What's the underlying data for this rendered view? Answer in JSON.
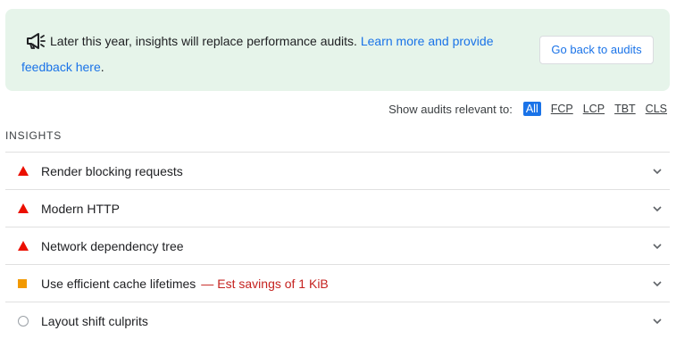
{
  "banner": {
    "message": "Later this year, insights will replace performance audits.",
    "link_text": "Learn more and provide feedback here",
    "suffix": ".",
    "back_button": "Go back to audits"
  },
  "filter": {
    "label": "Show audits relevant to:",
    "options": [
      "All",
      "FCP",
      "LCP",
      "TBT",
      "CLS"
    ],
    "selected": "All"
  },
  "insights": {
    "title": "INSIGHTS",
    "items": [
      {
        "label": "Render blocking requests",
        "status": "fail",
        "savings": ""
      },
      {
        "label": "Modern HTTP",
        "status": "fail",
        "savings": ""
      },
      {
        "label": "Network dependency tree",
        "status": "fail",
        "savings": ""
      },
      {
        "label": "Use efficient cache lifetimes",
        "status": "average",
        "savings": "Est savings of 1 KiB"
      },
      {
        "label": "Layout shift culprits",
        "status": "neutral",
        "savings": ""
      }
    ]
  },
  "colors": {
    "fail": "#eb0f00",
    "average": "#f29900",
    "neutral": "#9aa0a6",
    "accent": "#1a73e8",
    "banner_bg": "#e6f4ea"
  }
}
